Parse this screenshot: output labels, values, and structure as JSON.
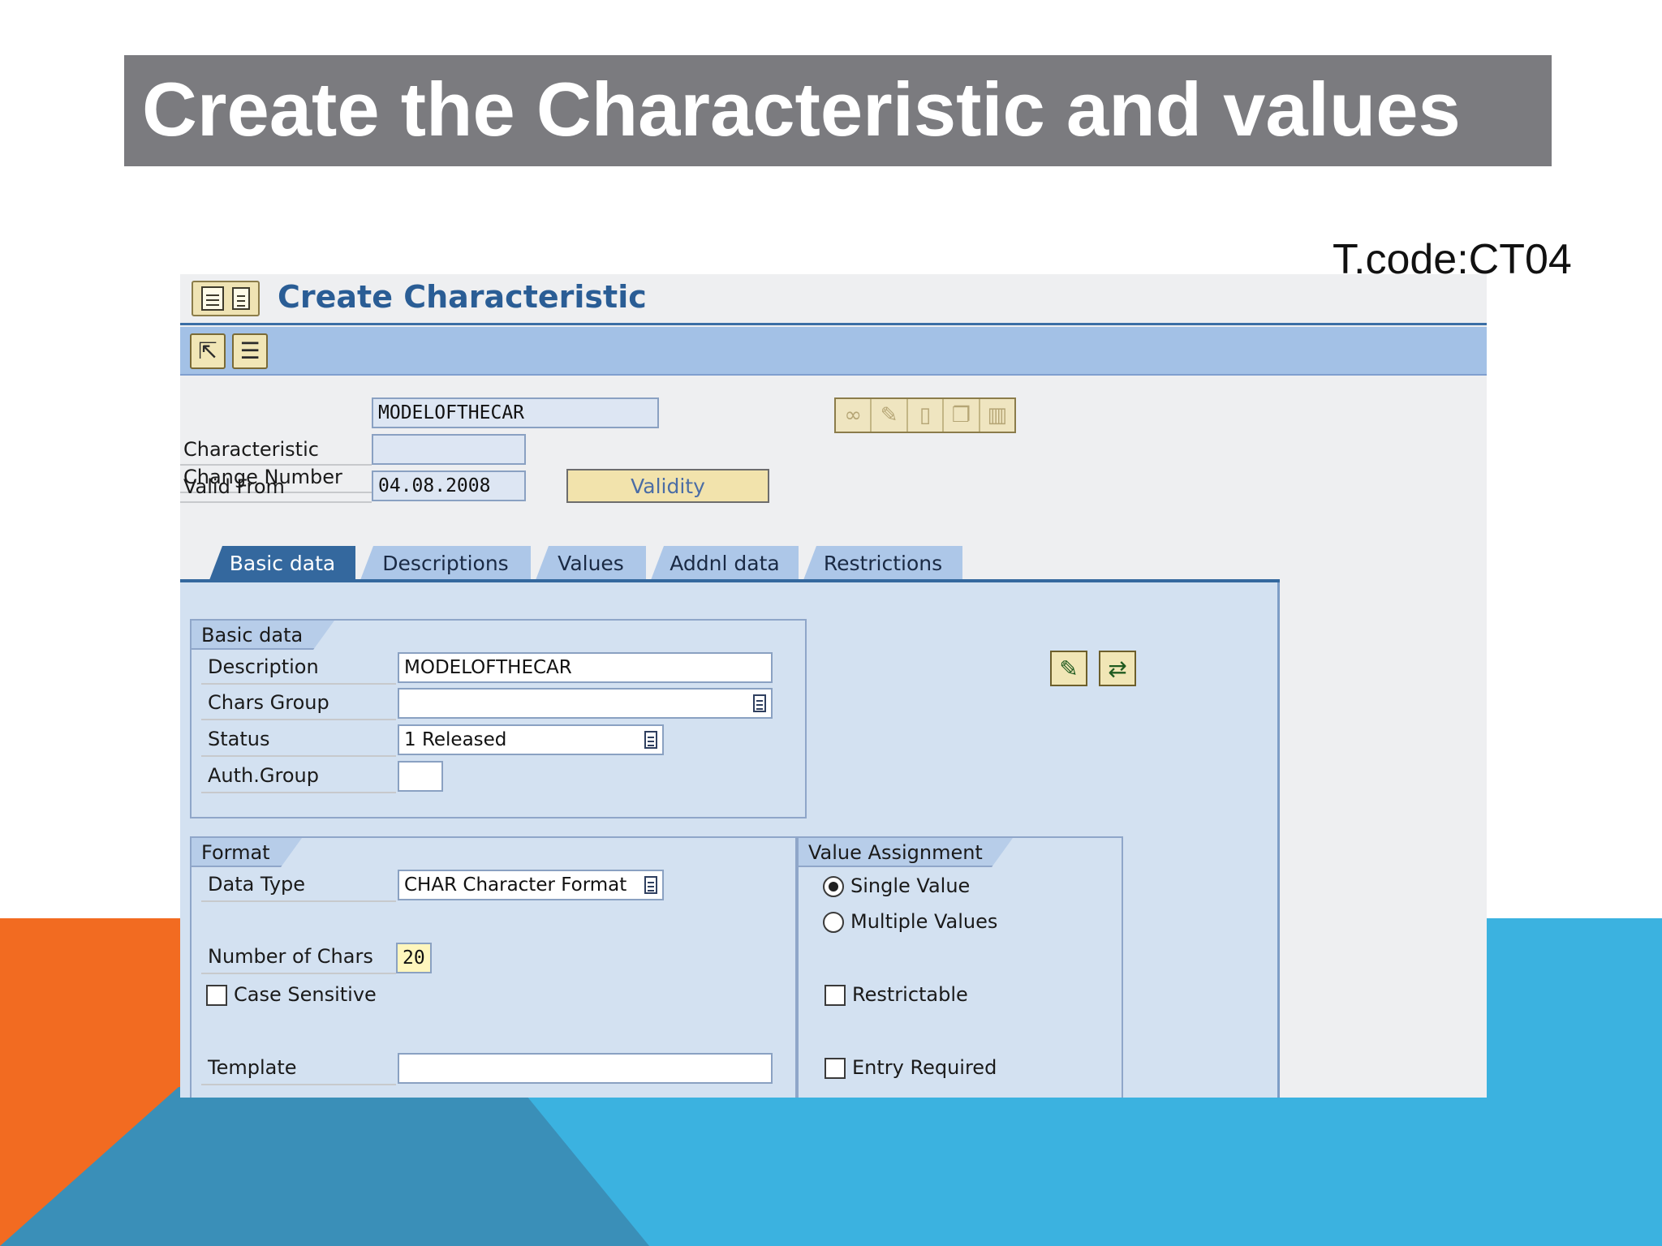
{
  "slide": {
    "title": "Create the Characteristic and values",
    "tcode": "T.code:CT04"
  },
  "screen": {
    "title": "Create Characteristic"
  },
  "header": {
    "characteristic_label": "Characteristic",
    "characteristic_value": "MODELOFTHECAR",
    "change_number_label": "Change Number",
    "change_number_value": "",
    "valid_from_label": "Valid From",
    "valid_from_value": "04.08.2008",
    "validity_button": "Validity"
  },
  "tabs": [
    {
      "label": "Basic data",
      "active": true
    },
    {
      "label": "Descriptions"
    },
    {
      "label": "Values"
    },
    {
      "label": "Addnl data"
    },
    {
      "label": "Restrictions"
    }
  ],
  "basic_data": {
    "header": "Basic data",
    "description_label": "Description",
    "description_value": "MODELOFTHECAR",
    "chars_group_label": "Chars Group",
    "chars_group_value": "",
    "status_label": "Status",
    "status_value": "1 Released",
    "auth_group_label": "Auth.Group",
    "auth_group_value": ""
  },
  "format": {
    "header": "Format",
    "data_type_label": "Data Type",
    "data_type_value": "CHAR Character Format",
    "num_chars_label": "Number of Chars",
    "num_chars_value": "20",
    "case_sensitive_label": "Case Sensitive",
    "case_sensitive_checked": false,
    "template_label": "Template",
    "template_value": ""
  },
  "value_assignment": {
    "header": "Value Assignment",
    "single_value_label": "Single Value",
    "multiple_values_label": "Multiple Values",
    "selected": "Single Value",
    "restrictable_label": "Restrictable",
    "entry_required_label": "Entry Required"
  },
  "icons": {
    "title_icons": [
      "display-change-icon",
      "document-icon"
    ],
    "toolbar": [
      "other-characteristic-icon",
      "hierarchy-icon"
    ],
    "header_actions": [
      "glasses-icon",
      "pencil-icon",
      "blank-page-icon",
      "copy-icon",
      "trash-icon"
    ],
    "panel_actions": [
      "edit-icon",
      "refresh-icon"
    ]
  },
  "colors": {
    "title_bar": "#7b7b7f",
    "orange": "#f26b21",
    "blue": "#3bb2e0",
    "sap_toolbar": "#a3c1e6",
    "active_tab": "#34689e"
  }
}
